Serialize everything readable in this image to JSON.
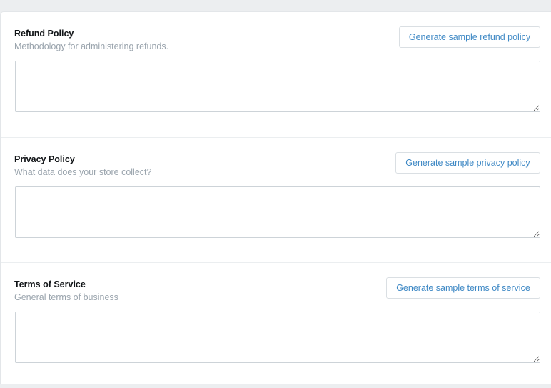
{
  "policies": [
    {
      "title": "Refund Policy",
      "subtitle": "Methodology for administering refunds.",
      "button_label": "Generate sample refund policy",
      "value": ""
    },
    {
      "title": "Privacy Policy",
      "subtitle": "What data does your store collect?",
      "button_label": "Generate sample privacy policy",
      "value": ""
    },
    {
      "title": "Terms of Service",
      "subtitle": "General terms of business",
      "button_label": "Generate sample terms of service",
      "value": ""
    }
  ]
}
